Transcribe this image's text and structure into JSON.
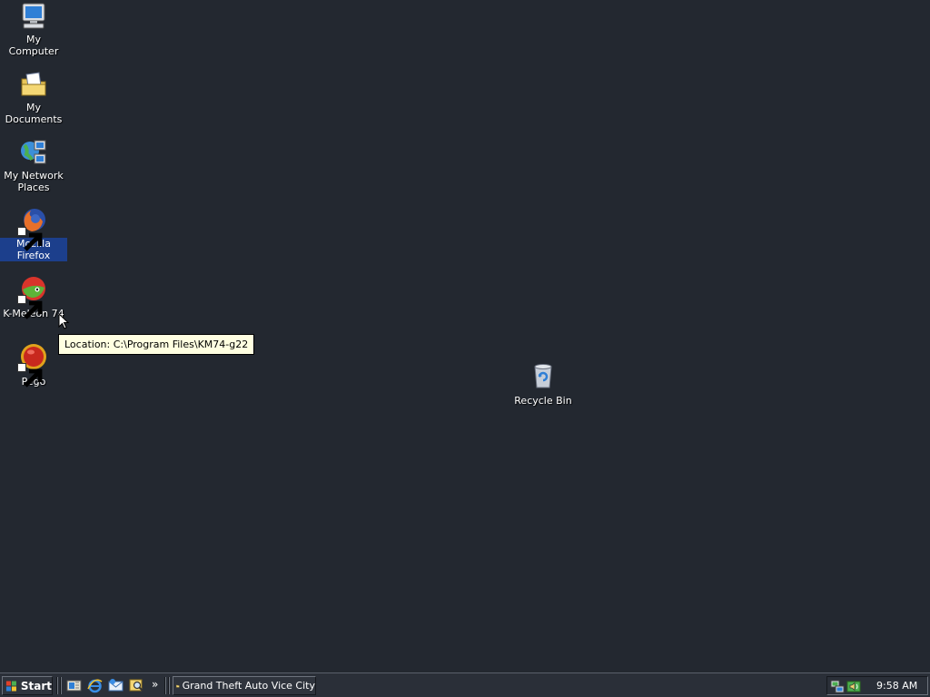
{
  "desktop": {
    "icons": [
      {
        "label": "My Computer",
        "icon": "my-computer-icon"
      },
      {
        "label": "My Documents",
        "icon": "my-documents-icon"
      },
      {
        "label": "My Network Places",
        "icon": "my-network-places-icon"
      },
      {
        "label": "Mozilla Firefox",
        "icon": "firefox-icon",
        "selected": true
      },
      {
        "label": "K-Meleon 74",
        "icon": "k-meleon-icon"
      },
      {
        "label": "Pego",
        "icon": "pego-icon"
      },
      {
        "label": "Recycle Bin",
        "icon": "recycle-bin-icon"
      }
    ],
    "tooltip": "Location: C:\\Program Files\\KM74-g22"
  },
  "taskbar": {
    "start_label": "Start",
    "quick_launch": [
      "show-desktop-icon",
      "internet-explorer-icon",
      "outlook-express-icon",
      "search-icon"
    ],
    "quick_launch_more": "»",
    "tasks": [
      {
        "label": "Grand Theft Auto Vice City",
        "icon": "folder-icon"
      }
    ],
    "tray": {
      "icons": [
        "network-icon",
        "volume-icon"
      ],
      "clock": "9:58 AM"
    }
  },
  "colors": {
    "desktop_bg": "#232830",
    "selection": "#1c3f8c",
    "tooltip_bg": "#ffffe1"
  }
}
